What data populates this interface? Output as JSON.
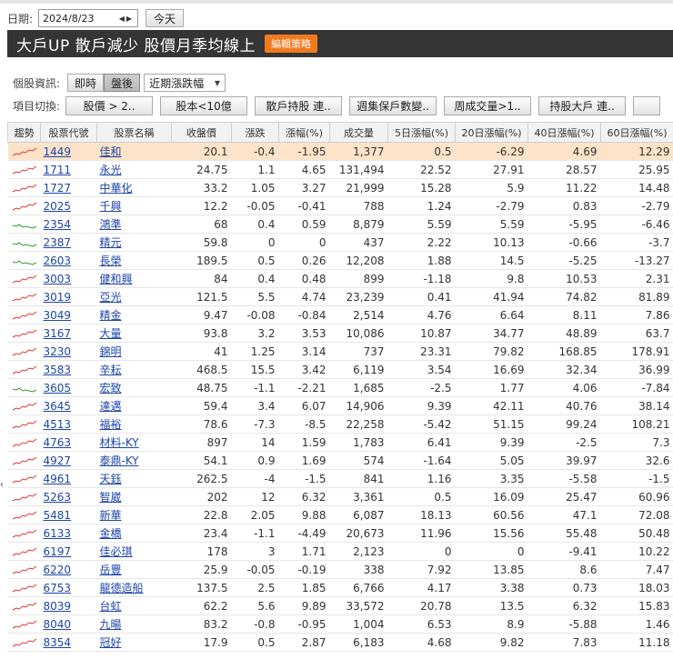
{
  "date_bar": {
    "label": "日期:",
    "date": "2024/8/23",
    "today": "今天"
  },
  "title": {
    "text": "大戶UP 散戶減少 股價月季均線上",
    "edit": "編輯策略"
  },
  "info": {
    "label": "個股資訊:",
    "realtime": "即時",
    "after": "盤後",
    "select": "近期漲跌幅"
  },
  "switch": {
    "label": "項目切換:",
    "items": [
      "股價 > 2..",
      "股本<10億",
      "散戶持股 連..",
      "週集保戶數變..",
      "周成交量>1..",
      "持股大戶 連.."
    ]
  },
  "colors": {
    "up": "#e0332d",
    "down": "#2a9d2a",
    "highlight": "#fde3c9",
    "title_bar": "#353535",
    "edit_button": "#f07a1e"
  },
  "table": {
    "headers": [
      "趨勢",
      "股票代號",
      "股票名稱",
      "收盤價",
      "漲跌",
      "漲幅(%)",
      "成交量",
      "5日漲幅(%)",
      "20日漲幅(%)",
      "40日漲幅(%)",
      "60日漲幅(%)"
    ],
    "rows": [
      {
        "code": "1449",
        "name": "佳和",
        "close": "20.1",
        "chg": "-0.4",
        "pct": "-1.95",
        "vol": "1,377",
        "d5": "0.5",
        "d20": "-6.29",
        "d40": "4.69",
        "d60": "12.29",
        "trend": "up"
      },
      {
        "code": "1711",
        "name": "永光",
        "close": "24.75",
        "chg": "1.1",
        "pct": "4.65",
        "vol": "131,494",
        "d5": "22.52",
        "d20": "27.91",
        "d40": "28.57",
        "d60": "25.95",
        "trend": "up"
      },
      {
        "code": "1727",
        "name": "中華化",
        "close": "33.2",
        "chg": "1.05",
        "pct": "3.27",
        "vol": "21,999",
        "d5": "15.28",
        "d20": "5.9",
        "d40": "11.22",
        "d60": "14.48",
        "trend": "up"
      },
      {
        "code": "2025",
        "name": "千興",
        "close": "12.2",
        "chg": "-0.05",
        "pct": "-0.41",
        "vol": "788",
        "d5": "1.24",
        "d20": "-2.79",
        "d40": "0.83",
        "d60": "-2.79",
        "trend": "up"
      },
      {
        "code": "2354",
        "name": "鴻準",
        "close": "68",
        "chg": "0.4",
        "pct": "0.59",
        "vol": "8,879",
        "d5": "5.59",
        "d20": "5.59",
        "d40": "-5.95",
        "d60": "-6.46",
        "trend": "down"
      },
      {
        "code": "2387",
        "name": "精元",
        "close": "59.8",
        "chg": "0",
        "pct": "0",
        "vol": "437",
        "d5": "2.22",
        "d20": "10.13",
        "d40": "-0.66",
        "d60": "-3.7",
        "trend": "down"
      },
      {
        "code": "2603",
        "name": "長榮",
        "close": "189.5",
        "chg": "0.5",
        "pct": "0.26",
        "vol": "12,208",
        "d5": "1.88",
        "d20": "14.5",
        "d40": "-5.25",
        "d60": "-13.27",
        "trend": "down"
      },
      {
        "code": "3003",
        "name": "健和興",
        "close": "84",
        "chg": "0.4",
        "pct": "0.48",
        "vol": "899",
        "d5": "-1.18",
        "d20": "9.8",
        "d40": "10.53",
        "d60": "2.31",
        "trend": "up"
      },
      {
        "code": "3019",
        "name": "亞光",
        "close": "121.5",
        "chg": "5.5",
        "pct": "4.74",
        "vol": "23,239",
        "d5": "0.41",
        "d20": "41.94",
        "d40": "74.82",
        "d60": "81.89",
        "trend": "up"
      },
      {
        "code": "3049",
        "name": "精金",
        "close": "9.47",
        "chg": "-0.08",
        "pct": "-0.84",
        "vol": "2,514",
        "d5": "4.76",
        "d20": "6.64",
        "d40": "8.11",
        "d60": "7.86",
        "trend": "up"
      },
      {
        "code": "3167",
        "name": "大量",
        "close": "93.8",
        "chg": "3.2",
        "pct": "3.53",
        "vol": "10,086",
        "d5": "10.87",
        "d20": "34.77",
        "d40": "48.89",
        "d60": "63.7",
        "trend": "up"
      },
      {
        "code": "3230",
        "name": "錦明",
        "close": "41",
        "chg": "1.25",
        "pct": "3.14",
        "vol": "737",
        "d5": "23.31",
        "d20": "79.82",
        "d40": "168.85",
        "d60": "178.91",
        "trend": "up"
      },
      {
        "code": "3583",
        "name": "辛耘",
        "close": "468.5",
        "chg": "15.5",
        "pct": "3.42",
        "vol": "6,119",
        "d5": "3.54",
        "d20": "16.69",
        "d40": "32.34",
        "d60": "36.99",
        "trend": "up"
      },
      {
        "code": "3605",
        "name": "宏致",
        "close": "48.75",
        "chg": "-1.1",
        "pct": "-2.21",
        "vol": "1,685",
        "d5": "-2.5",
        "d20": "1.77",
        "d40": "4.06",
        "d60": "-7.84",
        "trend": "down"
      },
      {
        "code": "3645",
        "name": "達邁",
        "close": "59.4",
        "chg": "3.4",
        "pct": "6.07",
        "vol": "14,906",
        "d5": "9.39",
        "d20": "42.11",
        "d40": "40.76",
        "d60": "38.14",
        "trend": "up"
      },
      {
        "code": "4513",
        "name": "福裕",
        "close": "78.6",
        "chg": "-7.3",
        "pct": "-8.5",
        "vol": "22,258",
        "d5": "-5.42",
        "d20": "51.15",
        "d40": "99.24",
        "d60": "108.21",
        "trend": "up"
      },
      {
        "code": "4763",
        "name": "材料-KY",
        "close": "897",
        "chg": "14",
        "pct": "1.59",
        "vol": "1,783",
        "d5": "6.41",
        "d20": "9.39",
        "d40": "-2.5",
        "d60": "7.3",
        "trend": "up"
      },
      {
        "code": "4927",
        "name": "泰鼎-KY",
        "close": "54.1",
        "chg": "0.9",
        "pct": "1.69",
        "vol": "574",
        "d5": "-1.64",
        "d20": "5.05",
        "d40": "39.97",
        "d60": "32.6",
        "trend": "up"
      },
      {
        "code": "4961",
        "name": "天鈺",
        "close": "262.5",
        "chg": "-4",
        "pct": "-1.5",
        "vol": "841",
        "d5": "1.16",
        "d20": "3.35",
        "d40": "-5.58",
        "d60": "-1.5",
        "trend": "up"
      },
      {
        "code": "5263",
        "name": "智崴",
        "close": "202",
        "chg": "12",
        "pct": "6.32",
        "vol": "3,361",
        "d5": "0.5",
        "d20": "16.09",
        "d40": "25.47",
        "d60": "60.96",
        "trend": "up"
      },
      {
        "code": "5481",
        "name": "新華",
        "close": "22.8",
        "chg": "2.05",
        "pct": "9.88",
        "vol": "6,087",
        "d5": "18.13",
        "d20": "60.56",
        "d40": "47.1",
        "d60": "72.08",
        "trend": "up"
      },
      {
        "code": "6133",
        "name": "金橋",
        "close": "23.4",
        "chg": "-1.1",
        "pct": "-4.49",
        "vol": "20,673",
        "d5": "11.96",
        "d20": "15.56",
        "d40": "55.48",
        "d60": "50.48",
        "trend": "up"
      },
      {
        "code": "6197",
        "name": "佳必琪",
        "close": "178",
        "chg": "3",
        "pct": "1.71",
        "vol": "2,123",
        "d5": "0",
        "d20": "0",
        "d40": "-9.41",
        "d60": "10.22",
        "trend": "up"
      },
      {
        "code": "6220",
        "name": "岳豐",
        "close": "25.9",
        "chg": "-0.05",
        "pct": "-0.19",
        "vol": "338",
        "d5": "7.92",
        "d20": "13.85",
        "d40": "8.6",
        "d60": "7.47",
        "trend": "up"
      },
      {
        "code": "6753",
        "name": "龍德造船",
        "close": "137.5",
        "chg": "2.5",
        "pct": "1.85",
        "vol": "6,766",
        "d5": "4.17",
        "d20": "3.38",
        "d40": "0.73",
        "d60": "18.03",
        "trend": "up"
      },
      {
        "code": "8039",
        "name": "台虹",
        "close": "62.2",
        "chg": "5.6",
        "pct": "9.89",
        "vol": "33,572",
        "d5": "20.78",
        "d20": "13.5",
        "d40": "6.32",
        "d60": "15.83",
        "trend": "up"
      },
      {
        "code": "8040",
        "name": "九暘",
        "close": "83.2",
        "chg": "-0.8",
        "pct": "-0.95",
        "vol": "1,004",
        "d5": "6.53",
        "d20": "8.9",
        "d40": "-5.88",
        "d60": "1.46",
        "trend": "up"
      },
      {
        "code": "8354",
        "name": "冠好",
        "close": "17.9",
        "chg": "0.5",
        "pct": "2.87",
        "vol": "6,183",
        "d5": "4.68",
        "d20": "9.82",
        "d40": "7.83",
        "d60": "11.18",
        "trend": "up"
      }
    ]
  }
}
